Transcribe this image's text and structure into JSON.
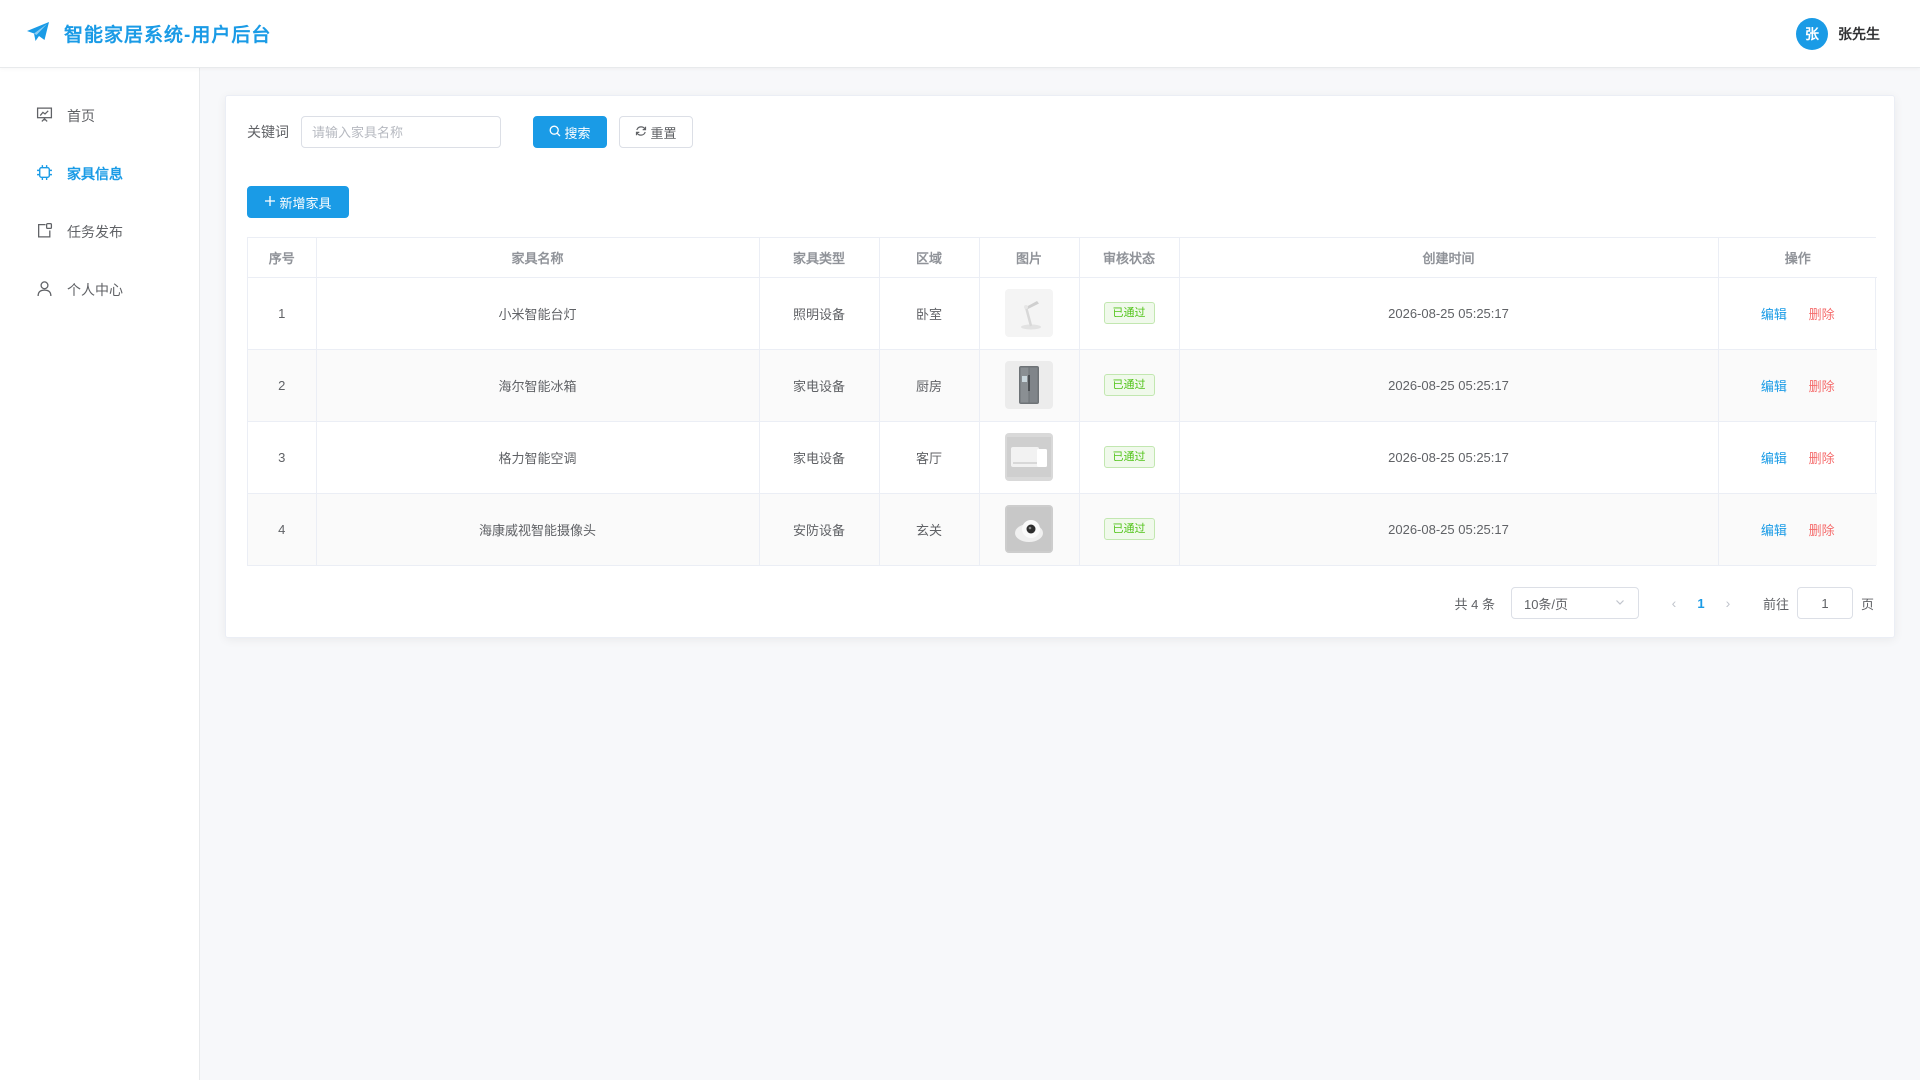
{
  "app": {
    "title": "智能家居系统-用户后台"
  },
  "user": {
    "avatar_text": "张",
    "name": "张先生"
  },
  "sidebar": {
    "items": [
      {
        "label": "首页",
        "icon": "presentation-board-icon",
        "active": false
      },
      {
        "label": "家具信息",
        "icon": "cpu-chip-icon",
        "active": true
      },
      {
        "label": "任务发布",
        "icon": "task-publish-icon",
        "active": false
      },
      {
        "label": "个人中心",
        "icon": "user-icon",
        "active": false
      }
    ]
  },
  "search": {
    "label": "关键词",
    "placeholder": "请输入家具名称",
    "value": "",
    "search_button": "搜索",
    "reset_button": "重置"
  },
  "toolbar": {
    "add_button": "新增家具"
  },
  "table": {
    "columns": [
      "序号",
      "家具名称",
      "家具类型",
      "区域",
      "图片",
      "审核状态",
      "创建时间",
      "操作"
    ],
    "rows": [
      {
        "index": "1",
        "name": "小米智能台灯",
        "type": "照明设备",
        "area": "卧室",
        "image": "desk-lamp",
        "status": "已通过",
        "created": "2026-08-25 05:25:17"
      },
      {
        "index": "2",
        "name": "海尔智能冰箱",
        "type": "家电设备",
        "area": "厨房",
        "image": "refrigerator",
        "status": "已通过",
        "created": "2026-08-25 05:25:17"
      },
      {
        "index": "3",
        "name": "格力智能空调",
        "type": "家电设备",
        "area": "客厅",
        "image": "air-conditioner",
        "status": "已通过",
        "created": "2026-08-25 05:25:17"
      },
      {
        "index": "4",
        "name": "海康威视智能摄像头",
        "type": "安防设备",
        "area": "玄关",
        "image": "security-camera",
        "status": "已通过",
        "created": "2026-08-25 05:25:17"
      }
    ],
    "actions": {
      "edit": "编辑",
      "delete": "删除"
    }
  },
  "pagination": {
    "total_text": "共 4 条",
    "page_size": "10条/页",
    "current_page": "1",
    "goto_label": "前往",
    "goto_value": "1",
    "page_suffix": "页"
  },
  "colors": {
    "accent": "#1a9be6",
    "danger": "#f56c6c",
    "success": "#52c41a"
  }
}
